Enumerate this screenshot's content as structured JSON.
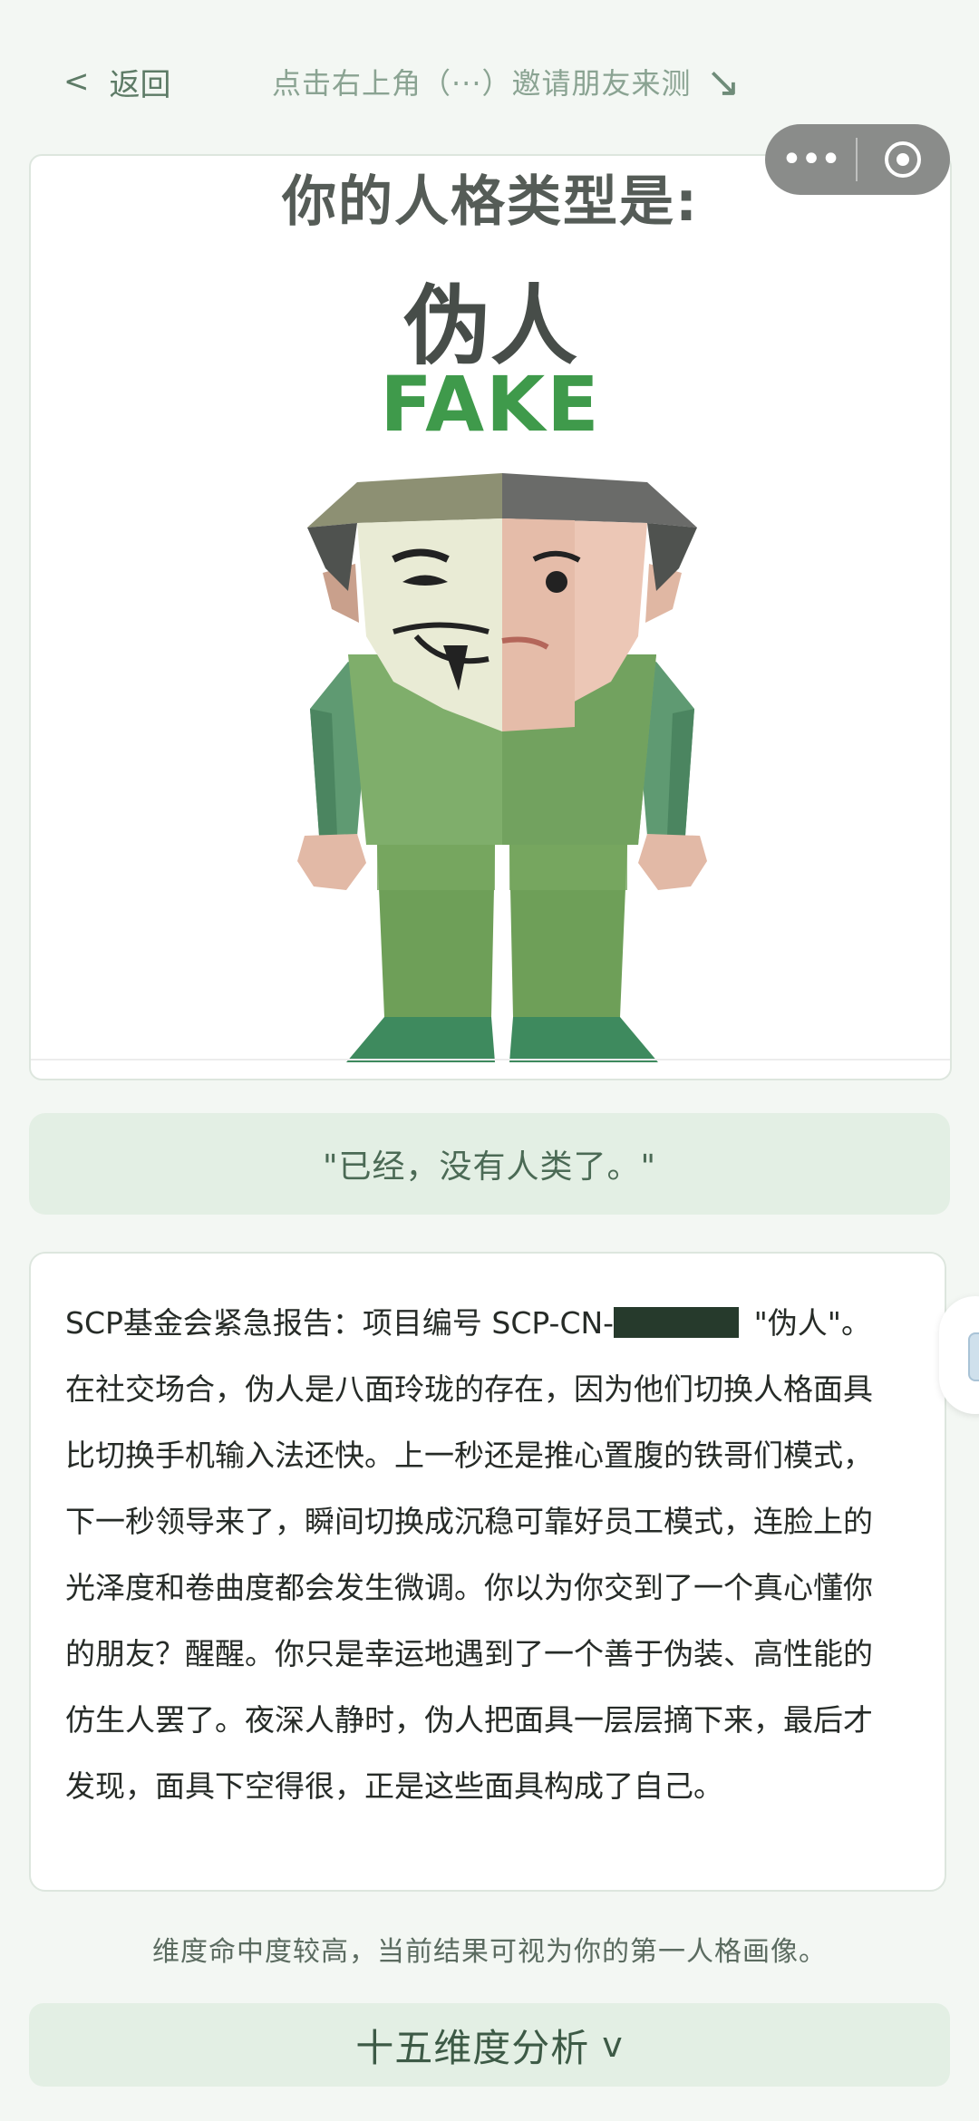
{
  "topbar": {
    "back_icon": "<",
    "back_label": "返回",
    "invite_hint": "点击右上角（···）邀请朋友来测",
    "invite_arrow": "↘"
  },
  "capsule": {
    "more_icon": "•••"
  },
  "result": {
    "heading": "你的人格类型是:",
    "type_cn": "伪人",
    "type_en": "FAKE"
  },
  "quote": "\"已经，没有人类了。\"",
  "description": {
    "prefix": "SCP基金会紧急报告：项目编号 SCP-CN-",
    "suffix": " \"伪人\"。在社交场合，伪人是八面玲珑的存在，因为他们切换人格面具比切换手机输入法还快。上一秒还是推心置腹的铁哥们模式，下一秒领导来了，瞬间切换成沉稳可靠好员工模式，连脸上的光泽度和卷曲度都会发生微调。你以为你交到了一个真心懂你的朋友？醒醒。你只是幸运地遇到了一个善于伪装、高性能的仿生人罢了。夜深人静时，伪人把面具一层层摘下来，最后才发现，面具下空得很，正是这些面具构成了自己。"
  },
  "hint": "维度命中度较高，当前结果可视为你的第一人格画像。",
  "dimension_button": {
    "label": "十五维度分析",
    "chevron": "v"
  },
  "colors": {
    "background": "#f3f7f3",
    "accent_green": "#3f9a4b",
    "soft_green": "#e3efe4"
  }
}
